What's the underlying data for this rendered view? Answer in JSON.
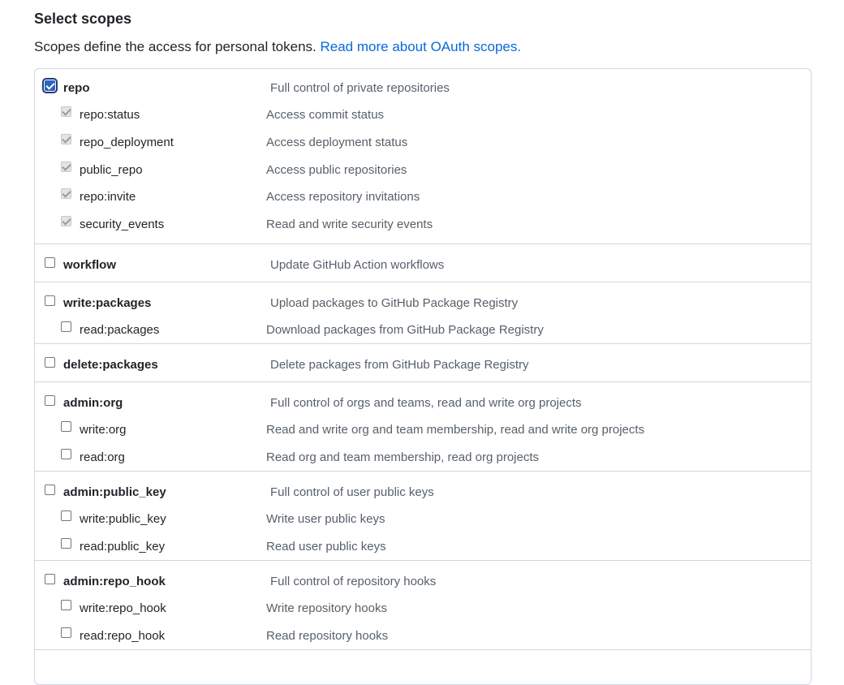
{
  "heading": "Select scopes",
  "description": {
    "text": "Scopes define the access for personal tokens.",
    "link": "Read more about OAuth scopes."
  },
  "groups": [
    {
      "id": "repo",
      "parent": {
        "name": "repo",
        "desc": "Full control of private repositories",
        "checked": true
      },
      "children": [
        {
          "name": "repo:status",
          "desc": "Access commit status",
          "checked": true,
          "disabled": true
        },
        {
          "name": "repo_deployment",
          "desc": "Access deployment status",
          "checked": true,
          "disabled": true
        },
        {
          "name": "public_repo",
          "desc": "Access public repositories",
          "checked": true,
          "disabled": true
        },
        {
          "name": "repo:invite",
          "desc": "Access repository invitations",
          "checked": true,
          "disabled": true
        },
        {
          "name": "security_events",
          "desc": "Read and write security events",
          "checked": true,
          "disabled": true
        }
      ]
    },
    {
      "id": "workflow",
      "parent": {
        "name": "workflow",
        "desc": "Update GitHub Action workflows",
        "checked": false
      },
      "children": []
    },
    {
      "id": "write-packages",
      "parent": {
        "name": "write:packages",
        "desc": "Upload packages to GitHub Package Registry",
        "checked": false
      },
      "children": [
        {
          "name": "read:packages",
          "desc": "Download packages from GitHub Package Registry",
          "checked": false,
          "disabled": false
        }
      ]
    },
    {
      "id": "delete-packages",
      "parent": {
        "name": "delete:packages",
        "desc": "Delete packages from GitHub Package Registry",
        "checked": false
      },
      "children": []
    },
    {
      "id": "admin-org",
      "parent": {
        "name": "admin:org",
        "desc": "Full control of orgs and teams, read and write org projects",
        "checked": false
      },
      "children": [
        {
          "name": "write:org",
          "desc": "Read and write org and team membership, read and write org projects",
          "checked": false,
          "disabled": false
        },
        {
          "name": "read:org",
          "desc": "Read org and team membership, read org projects",
          "checked": false,
          "disabled": false
        }
      ]
    },
    {
      "id": "admin-public-key",
      "parent": {
        "name": "admin:public_key",
        "desc": "Full control of user public keys",
        "checked": false
      },
      "children": [
        {
          "name": "write:public_key",
          "desc": "Write user public keys",
          "checked": false,
          "disabled": false
        },
        {
          "name": "read:public_key",
          "desc": "Read user public keys",
          "checked": false,
          "disabled": false
        }
      ]
    },
    {
      "id": "admin-repo-hook",
      "parent": {
        "name": "admin:repo_hook",
        "desc": "Full control of repository hooks",
        "checked": false
      },
      "children": [
        {
          "name": "write:repo_hook",
          "desc": "Write repository hooks",
          "checked": false,
          "disabled": false
        },
        {
          "name": "read:repo_hook",
          "desc": "Read repository hooks",
          "checked": false,
          "disabled": false
        }
      ]
    }
  ]
}
